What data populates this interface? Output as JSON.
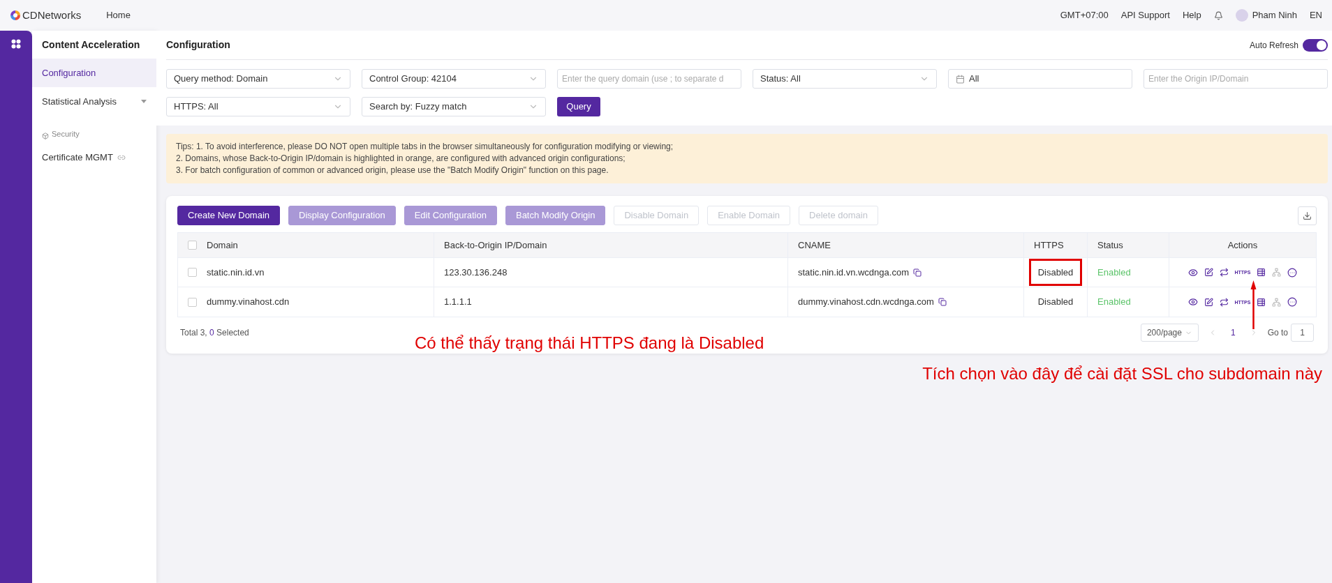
{
  "topbar": {
    "brand": "CDNetworks",
    "nav": "Home",
    "timezone": "GMT+07:00",
    "links": [
      "API Support",
      "Help"
    ],
    "user": "Pham Ninh",
    "language": "EN"
  },
  "sidebar": {
    "title": "Content Acceleration",
    "items": [
      {
        "label": "Configuration",
        "selected": true,
        "kind": "item"
      },
      {
        "label": "Statistical Analysis",
        "selected": false,
        "kind": "dropdown"
      }
    ],
    "section": {
      "label": "Security",
      "items": [
        {
          "label": "Certificate MGMT",
          "selected": false
        }
      ]
    }
  },
  "page": {
    "title": "Configuration",
    "auto_refresh": {
      "label": "Auto Refresh",
      "on": true
    }
  },
  "filters": [
    {
      "kind": "select",
      "value": "Query method: Domain"
    },
    {
      "kind": "select",
      "value": "Control Group: 42104"
    },
    {
      "kind": "input",
      "placeholder": "Enter the query domain (use ; to separate d"
    },
    {
      "kind": "select",
      "value": "Status: All"
    },
    {
      "kind": "date",
      "value": "All"
    },
    {
      "kind": "input",
      "placeholder": "Enter the Origin IP/Domain"
    },
    {
      "kind": "select",
      "value": "HTTPS: All"
    },
    {
      "kind": "select",
      "value": "Search by: Fuzzy match"
    },
    {
      "kind": "button",
      "value": "Query"
    }
  ],
  "tips": [
    "Tips: 1. To avoid interference, please DO NOT open multiple tabs in the browser simultaneously for configuration modifying or viewing;",
    "2. Domains, whose Back-to-Origin IP/domain is highlighted in orange, are configured with advanced origin configurations;",
    "3. For batch configuration of common or advanced origin, please use the \"Batch Modify Origin\" function on this page."
  ],
  "toolbar": [
    {
      "label": "Create New Domain",
      "kind": "primary"
    },
    {
      "label": "Display Configuration",
      "kind": "muted"
    },
    {
      "label": "Edit Configuration",
      "kind": "muted"
    },
    {
      "label": "Batch Modify Origin",
      "kind": "muted"
    },
    {
      "label": "Disable Domain",
      "kind": "disabled"
    },
    {
      "label": "Enable Domain",
      "kind": "disabled"
    },
    {
      "label": "Delete domain",
      "kind": "disabled"
    }
  ],
  "table": {
    "all_checked": false,
    "columns": [
      "Domain",
      "Back-to-Origin IP/Domain",
      "CNAME",
      "HTTPS",
      "Status",
      "Actions"
    ],
    "rows": [
      {
        "checked": false,
        "domain": "static.nin.id.vn",
        "origin": "123.30.136.248",
        "cname": "static.nin.id.vn.wcdnga.com",
        "https": "Disabled",
        "https_highlighted": true,
        "status": "Enabled",
        "https_action": "HTTPS"
      },
      {
        "checked": false,
        "domain": "dummy.vinahost.cdn",
        "origin": "1.1.1.1",
        "cname": "dummy.vinahost.cdn.wcdnga.com",
        "https": "Disabled",
        "https_highlighted": false,
        "status": "Enabled",
        "https_action": "HTTPS"
      }
    ]
  },
  "footer": {
    "total": "Total 3,",
    "selected_count": "0",
    "selected_label": "Selected",
    "page_size": "200/page",
    "page": "1",
    "goto_label": "Go to",
    "goto_value": "1"
  },
  "annotations": [
    "Có thể thấy trạng thái HTTPS đang là Disabled",
    "Tích chọn vào  đây để cài đặt SSL cho subdomain này"
  ]
}
